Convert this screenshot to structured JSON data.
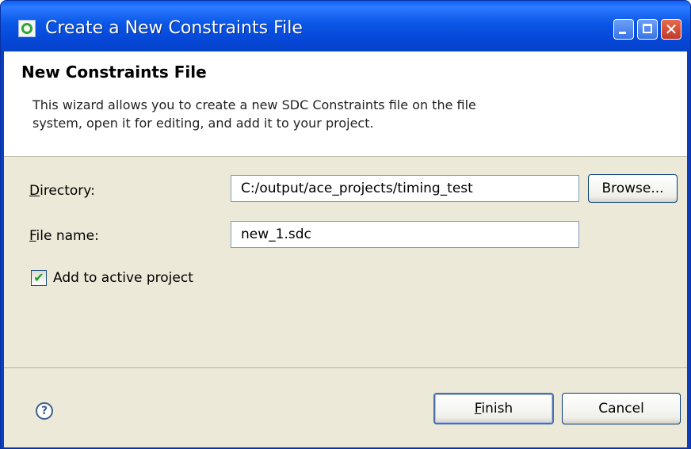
{
  "window": {
    "title": "Create a New Constraints File",
    "controls": {
      "minimize_icon": "minimize-icon",
      "maximize_icon": "maximize-icon",
      "close_icon": "close-icon",
      "close_glyph": "✕"
    }
  },
  "banner": {
    "title": "New Constraints File",
    "description_line1": "This wizard allows you to create a new SDC Constraints file on the file",
    "description_line2": "system, open it for editing, and add it to your project."
  },
  "form": {
    "directory": {
      "label_mnemonic": "D",
      "label_rest": "irectory:",
      "value": "C:/output/ace_projects/timing_test",
      "browse_label": "Browse..."
    },
    "file_name": {
      "label_mnemonic": "F",
      "label_rest": "ile name:",
      "value": "new_1.sdc"
    },
    "add_to_project": {
      "label": "Add to active project",
      "checked": true,
      "check_glyph": "✔"
    }
  },
  "footer": {
    "help_glyph": "?",
    "finish_mnemonic": "F",
    "finish_rest": "inish",
    "cancel_label": "Cancel"
  }
}
